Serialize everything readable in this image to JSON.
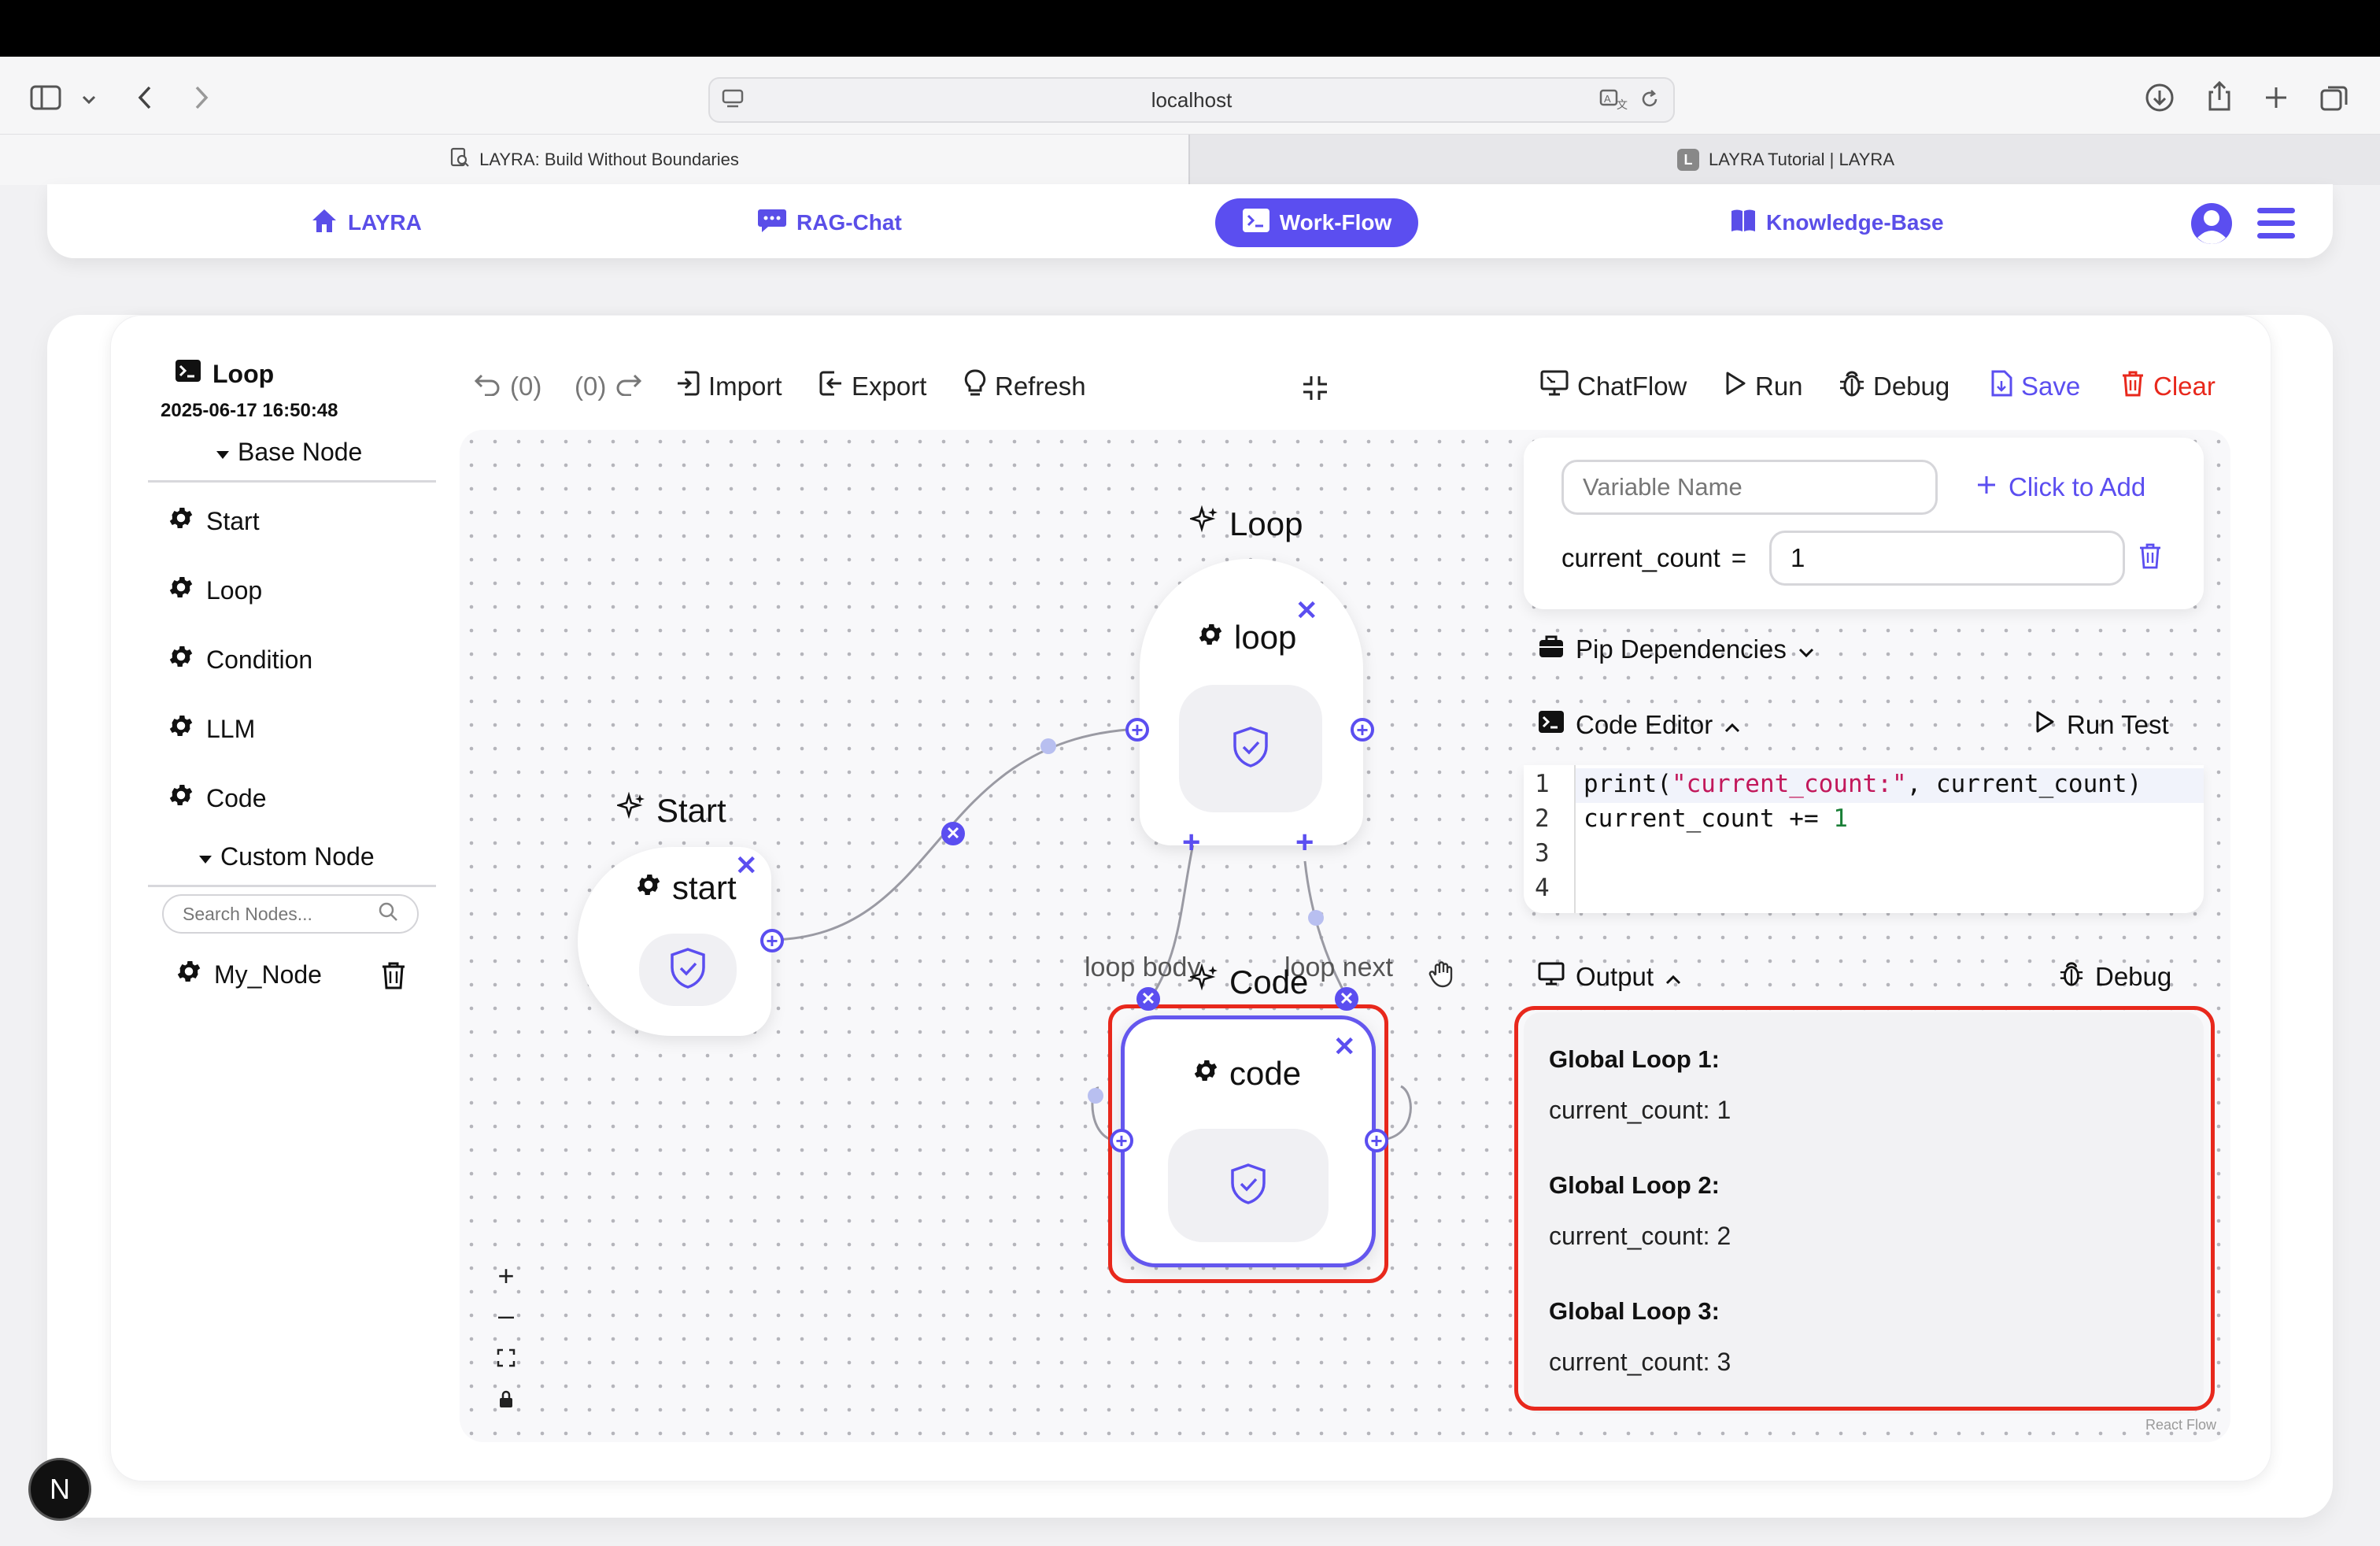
{
  "browser": {
    "url": "localhost",
    "tabs": [
      {
        "label": "LAYRA: Build Without Boundaries"
      },
      {
        "label": "LAYRA Tutorial | LAYRA",
        "favicon": "L"
      }
    ]
  },
  "nav": {
    "items": [
      {
        "label": "LAYRA",
        "icon": "home-icon"
      },
      {
        "label": "RAG-Chat",
        "icon": "chat-icon"
      },
      {
        "label": "Work-Flow",
        "icon": "terminal-icon",
        "active": true
      },
      {
        "label": "Knowledge-Base",
        "icon": "book-icon"
      }
    ],
    "accent": "#5b4ef0"
  },
  "workflow": {
    "name": "Loop",
    "timestamp": "2025-06-17 16:50:48"
  },
  "left_panel": {
    "base_section": "Base Node",
    "base_nodes": [
      "Start",
      "Loop",
      "Condition",
      "LLM",
      "Code"
    ],
    "custom_section": "Custom Node",
    "search_placeholder": "Search Nodes...",
    "custom_nodes": [
      "My_Node"
    ]
  },
  "toolbar": {
    "undo_count": "(0)",
    "redo_count": "(0)",
    "import": "Import",
    "export": "Export",
    "refresh": "Refresh",
    "chatflow": "ChatFlow",
    "run": "Run",
    "debug": "Debug",
    "save": "Save",
    "clear": "Clear"
  },
  "canvas": {
    "nodes": {
      "start": {
        "title": "Start",
        "name": "start"
      },
      "loop": {
        "title": "Loop",
        "name": "loop"
      },
      "code": {
        "title": "Code",
        "name": "code"
      }
    },
    "edge_labels": {
      "loop_body": "loop body",
      "loop_next": "loop next"
    },
    "watermark": "React Flow"
  },
  "right_panel": {
    "variable_placeholder": "Variable Name",
    "add_label": "Click to Add",
    "variable": {
      "name": "current_count",
      "eq": "=",
      "value": "1"
    },
    "pip_label": "Pip Dependencies",
    "code_editor_label": "Code Editor",
    "run_test_label": "Run Test",
    "code_lines": [
      {
        "num": "1",
        "tokens": [
          {
            "t": "print(",
            "c": "#111"
          },
          {
            "t": "\"current_count:\"",
            "c": "#c2185b"
          },
          {
            "t": ", current_count)",
            "c": "#111"
          }
        ]
      },
      {
        "num": "2",
        "tokens": [
          {
            "t": "current_count += ",
            "c": "#111"
          },
          {
            "t": "1",
            "c": "#1a7f37"
          }
        ]
      },
      {
        "num": "3",
        "tokens": []
      },
      {
        "num": "4",
        "tokens": []
      }
    ],
    "output_label": "Output",
    "debug_label": "Debug",
    "output": [
      {
        "label": "Global Loop 1:",
        "value": "current_count: 1"
      },
      {
        "label": "Global Loop 2:",
        "value": "current_count: 2"
      },
      {
        "label": "Global Loop 3:",
        "value": "current_count: 3"
      }
    ]
  },
  "colors": {
    "danger": "#e8281c",
    "accent": "#5b4ef0"
  }
}
